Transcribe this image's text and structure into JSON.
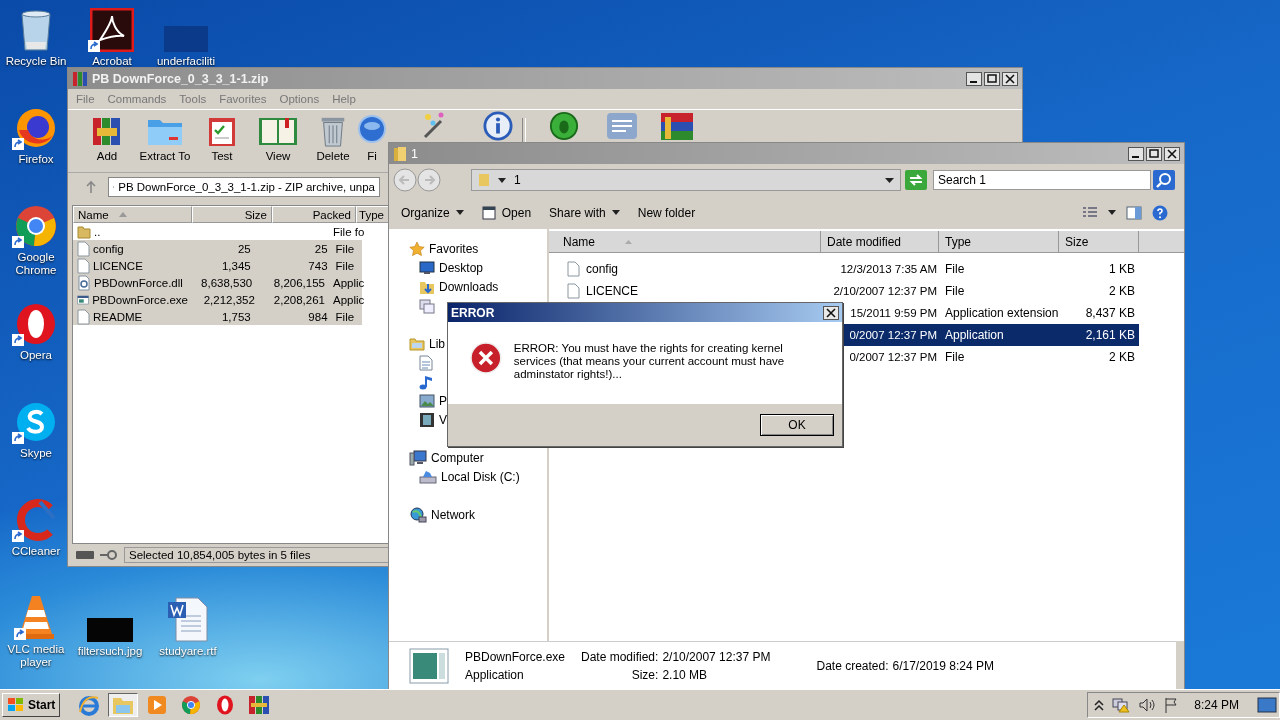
{
  "desktop_icons": [
    {
      "label": "Recycle Bin",
      "kind": "recycle",
      "shortcut": false
    },
    {
      "label": "Acrobat",
      "kind": "acrobat",
      "shortcut": true
    },
    {
      "label": "underfaciliti",
      "kind": "blank",
      "shortcut": false
    },
    {
      "label": "Firefox",
      "kind": "firefox",
      "shortcut": true
    },
    {
      "label": "Google Chrome",
      "kind": "chrome",
      "shortcut": true
    },
    {
      "label": "Opera",
      "kind": "opera",
      "shortcut": true
    },
    {
      "label": "Skype",
      "kind": "skype",
      "shortcut": true
    },
    {
      "label": "CCleaner",
      "kind": "ccleaner",
      "shortcut": true
    },
    {
      "label": "VLC media player",
      "kind": "vlc",
      "shortcut": true
    },
    {
      "label": "filtersuch.jpg",
      "kind": "image",
      "shortcut": false
    },
    {
      "label": "studyare.rtf",
      "kind": "word",
      "shortcut": false
    }
  ],
  "winrar": {
    "title": "PB DownForce_0_3_3_1-1.zip",
    "menu": [
      "File",
      "Commands",
      "Tools",
      "Favorites",
      "Options",
      "Help"
    ],
    "toolbar": [
      [
        {
          "label": "Add",
          "kind": "add"
        },
        {
          "label": "Extract To",
          "kind": "extract"
        },
        {
          "label": "Test",
          "kind": "test"
        },
        {
          "label": "View",
          "kind": "view"
        },
        {
          "label": "Delete",
          "kind": "delete"
        },
        {
          "label": "Fi",
          "kind": "find"
        },
        {
          "kind": "wizard"
        },
        {
          "kind": "info"
        }
      ],
      [
        {
          "kind": "virus"
        },
        {
          "kind": "comment"
        },
        {
          "kind": "sfx"
        }
      ]
    ],
    "address": "PB DownForce_0_3_3_1-1.zip - ZIP archive, unpa",
    "columns": [
      {
        "label": "Name",
        "sorted": true
      },
      {
        "label": "Size",
        "sorted": false
      },
      {
        "label": "Packed",
        "sorted": false
      },
      {
        "label": "Type"
      }
    ],
    "rows": [
      {
        "name": "..",
        "size": "",
        "packed": "",
        "type": "File fo",
        "kind": "folder",
        "selected": false
      },
      {
        "name": "config",
        "size": "25",
        "packed": "25",
        "type": "File",
        "kind": "file",
        "selected": true
      },
      {
        "name": "LICENCE",
        "size": "1,345",
        "packed": "743",
        "type": "File",
        "kind": "file",
        "selected": true
      },
      {
        "name": "PBDownForce.dll",
        "size": "8,638,530",
        "packed": "8,206,155",
        "type": "Applic",
        "kind": "dll",
        "selected": true
      },
      {
        "name": "PBDownForce.exe",
        "size": "2,212,352",
        "packed": "2,208,261",
        "type": "Applic",
        "kind": "exe",
        "selected": true
      },
      {
        "name": "README",
        "size": "1,753",
        "packed": "984",
        "type": "File",
        "kind": "file",
        "selected": true
      }
    ],
    "status": "Selected 10,854,005 bytes in 5 files"
  },
  "explorer": {
    "title": "1",
    "address": "1",
    "search": {
      "placeholder": "Search 1"
    },
    "commands": [
      {
        "label": "Organize",
        "kind": "menu"
      },
      {
        "label": "Open",
        "kind": "open"
      },
      {
        "label": "Share with",
        "kind": "menu"
      },
      {
        "label": "New folder",
        "kind": "plain"
      }
    ],
    "nav": [
      {
        "label": "Favorites",
        "kind": "star",
        "children": [
          {
            "label": "Desktop",
            "kind": "desktop"
          },
          {
            "label": "Downloads",
            "kind": "downloads"
          },
          {
            "kind": "recent"
          }
        ]
      },
      {
        "label": "Lib",
        "kind": "libraries",
        "children": [
          {
            "kind": "document"
          },
          {
            "kind": "music"
          },
          {
            "label": "P",
            "kind": "pictures"
          },
          {
            "label": "V",
            "kind": "videos"
          }
        ]
      },
      {
        "label": "Computer",
        "kind": "computer",
        "children": [
          {
            "label": "Local Disk (C:)",
            "kind": "disk"
          }
        ]
      },
      {
        "label": "Network",
        "kind": "network"
      }
    ],
    "columns": [
      {
        "label": "Name",
        "sorted": true
      },
      {
        "label": "Date modified",
        "sorted": false
      },
      {
        "label": "Type",
        "sorted": false
      },
      {
        "label": "Size",
        "sorted": false
      }
    ],
    "rows": [
      {
        "name": "config",
        "date": "12/3/2013 7:35 AM",
        "type": "File",
        "size": "1 KB",
        "selected": false
      },
      {
        "name": "LICENCE",
        "date": "2/10/2007 12:37 PM",
        "type": "File",
        "size": "2 KB",
        "selected": false
      },
      {
        "date": "15/2011 9:59 PM",
        "type": "Application extension",
        "size": "8,437 KB",
        "selected": false
      },
      {
        "date": "0/2007 12:37 PM",
        "type": "Application",
        "size": "2,161 KB",
        "selected": true
      },
      {
        "date": "0/2007 12:37 PM",
        "type": "File",
        "size": "2 KB",
        "selected": false
      }
    ],
    "details": {
      "name": "PBDownForce.exe",
      "type": "Application",
      "fields": [
        [
          {
            "label": "Date modified:",
            "value": "2/10/2007 12:37 PM"
          },
          {
            "label": "Size:",
            "value": "2.10 MB"
          }
        ],
        [
          {
            "label": "Date created:",
            "value": "6/17/2019 8:24 PM"
          }
        ]
      ]
    }
  },
  "dialog": {
    "title": "ERROR",
    "message": "ERROR: You must have the rights for creating kernel services (that means your current account must have adminstator rights!)...",
    "button": "OK"
  },
  "taskbar": {
    "start": "Start",
    "apps": [
      {
        "kind": "ie",
        "selected": false
      },
      {
        "kind": "explorer",
        "selected": true
      },
      {
        "kind": "media",
        "selected": false
      },
      {
        "kind": "chrome",
        "selected": false
      },
      {
        "kind": "opera",
        "selected": false
      },
      {
        "kind": "winrar",
        "selected": false
      }
    ],
    "tray": [
      {
        "kind": "arrow"
      },
      {
        "kind": "network"
      },
      {
        "kind": "speaker"
      },
      {
        "kind": "flag"
      }
    ],
    "clock": "8:24 PM"
  }
}
